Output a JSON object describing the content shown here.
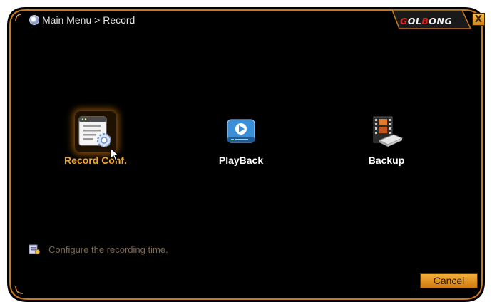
{
  "window": {
    "breadcrumb": "Main Menu > Record",
    "brand": {
      "part1_red": "G",
      "part1": "OL",
      "part2_red": "B",
      "part2": "ONG"
    },
    "close_label": "X"
  },
  "menu": {
    "items": [
      {
        "label": "Record Conf.",
        "icon": "record-config-icon",
        "active": true
      },
      {
        "label": "PlayBack",
        "icon": "playback-icon",
        "active": false
      },
      {
        "label": "Backup",
        "icon": "backup-icon",
        "active": false
      }
    ]
  },
  "hint": {
    "text": "Configure the recording time.",
    "icon": "hint-icon"
  },
  "actions": {
    "cancel_label": "Cancel"
  },
  "colors": {
    "background": "#000000",
    "accent": "#f5a623",
    "frame_border": "#c8781e",
    "brand_red": "#e0221c"
  }
}
